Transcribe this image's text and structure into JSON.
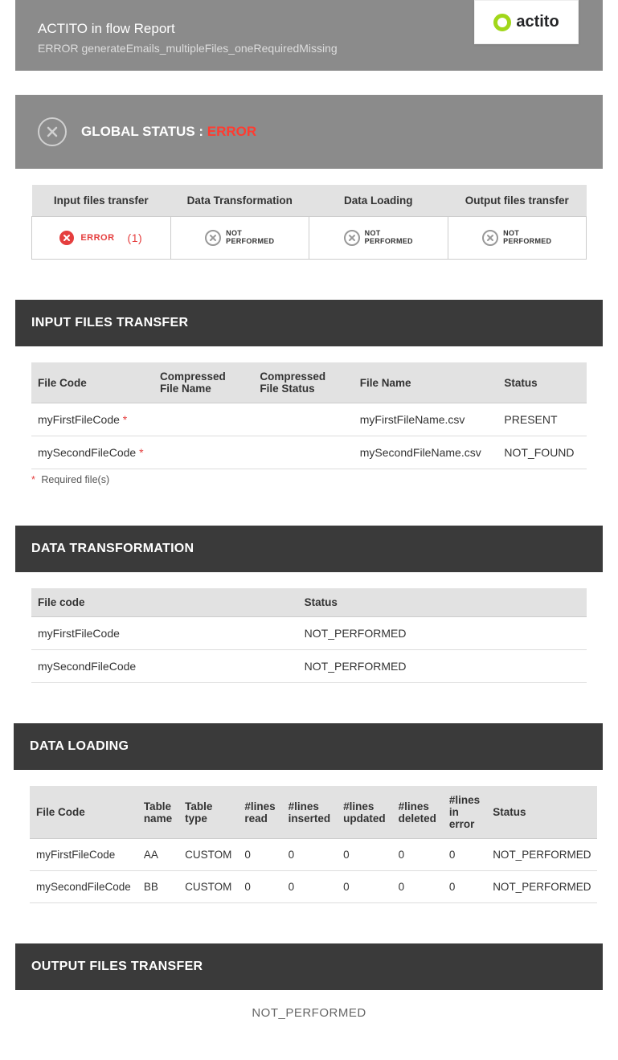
{
  "header": {
    "title": "ACTITO in flow Report",
    "subtitle": "ERROR generateEmails_multipleFiles_oneRequiredMissing",
    "logo_text": "actito"
  },
  "global_status": {
    "label_prefix": "GLOBAL STATUS : ",
    "value": "ERROR"
  },
  "stages": {
    "headers": [
      "Input files transfer",
      "Data Transformation",
      "Data Loading",
      "Output files transfer"
    ],
    "error_label": "ERROR",
    "error_count": "(1)",
    "not_performed_line1": "NOT",
    "not_performed_line2": "PERFORMED"
  },
  "input_files": {
    "section_title": "INPUT FILES TRANSFER",
    "columns": [
      "File Code",
      "Compressed File Name",
      "Compressed File Status",
      "File Name",
      "Status"
    ],
    "rows": [
      {
        "file_code": "myFirstFileCode",
        "required": "*",
        "c_name": "",
        "c_status": "",
        "file_name": "myFirstFileName.csv",
        "status": "PRESENT",
        "status_class": "present"
      },
      {
        "file_code": "mySecondFileCode",
        "required": "*",
        "c_name": "",
        "c_status": "",
        "file_name": "mySecondFileName.csv",
        "status": "NOT_FOUND",
        "status_class": "notfound"
      }
    ],
    "footnote_star": "*",
    "footnote_text": " Required file(s)"
  },
  "data_transformation": {
    "section_title": "DATA TRANSFORMATION",
    "columns": [
      "File code",
      "Status"
    ],
    "rows": [
      {
        "file_code": "myFirstFileCode",
        "status": "NOT_PERFORMED"
      },
      {
        "file_code": "mySecondFileCode",
        "status": "NOT_PERFORMED"
      }
    ]
  },
  "data_loading": {
    "section_title": "DATA LOADING",
    "columns": [
      "File Code",
      "Table name",
      "Table type",
      "#lines read",
      "#lines inserted",
      "#lines updated",
      "#lines deleted",
      "#lines in error",
      "Status"
    ],
    "rows": [
      {
        "file_code": "myFirstFileCode",
        "table_name": "AA",
        "table_type": "CUSTOM",
        "read": "0",
        "inserted": "0",
        "updated": "0",
        "deleted": "0",
        "in_error": "0",
        "status": "NOT_PERFORMED"
      },
      {
        "file_code": "mySecondFileCode",
        "table_name": "BB",
        "table_type": "CUSTOM",
        "read": "0",
        "inserted": "0",
        "updated": "0",
        "deleted": "0",
        "in_error": "0",
        "status": "NOT_PERFORMED"
      }
    ]
  },
  "output_files": {
    "section_title": "OUTPUT FILES TRANSFER",
    "body": "NOT_PERFORMED"
  }
}
